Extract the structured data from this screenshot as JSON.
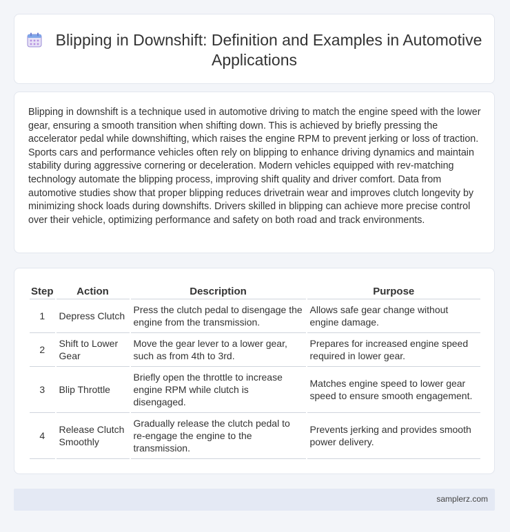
{
  "header": {
    "icon": "calendar-icon",
    "title": "Blipping in Downshift: Definition and Examples in Automotive Applications"
  },
  "intro": {
    "text": "Blipping in downshift is a technique used in automotive driving to match the engine speed with the lower gear, ensuring a smooth transition when shifting down. This is achieved by briefly pressing the accelerator pedal while downshifting, which raises the engine RPM to prevent jerking or loss of traction. Sports cars and performance vehicles often rely on blipping to enhance driving dynamics and maintain stability during aggressive cornering or deceleration. Modern vehicles equipped with rev-matching technology automate the blipping process, improving shift quality and driver comfort. Data from automotive studies show that proper blipping reduces drivetrain wear and improves clutch longevity by minimizing shock loads during downshifts. Drivers skilled in blipping can achieve more precise control over their vehicle, optimizing performance and safety on both road and track environments."
  },
  "table": {
    "headers": [
      "Step",
      "Action",
      "Description",
      "Purpose"
    ],
    "rows": [
      [
        "1",
        "Depress Clutch",
        "Press the clutch pedal to disengage the engine from the transmission.",
        "Allows safe gear change without engine damage."
      ],
      [
        "2",
        "Shift to Lower Gear",
        "Move the gear lever to a lower gear, such as from 4th to 3rd.",
        "Prepares for increased engine speed required in lower gear."
      ],
      [
        "3",
        "Blip Throttle",
        "Briefly open the throttle to increase engine RPM while clutch is disengaged.",
        "Matches engine speed to lower gear speed to ensure smooth engagement."
      ],
      [
        "4",
        "Release Clutch Smoothly",
        "Gradually release the clutch pedal to re-engage the engine to the transmission.",
        "Prevents jerking and provides smooth power delivery."
      ]
    ]
  },
  "footer": {
    "site": "samplerz.com"
  }
}
